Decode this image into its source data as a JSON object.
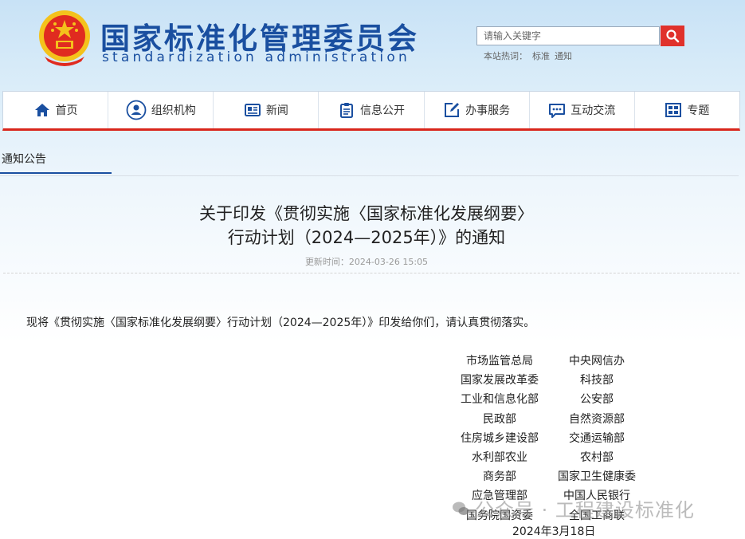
{
  "header": {
    "title": "国家标准化管理委员会",
    "subtitle": "standardization administration",
    "search_placeholder": "请输入关键字",
    "hot_label": "本站热词：",
    "hot_words": [
      "标准",
      "通知"
    ]
  },
  "nav": {
    "items": [
      {
        "label": "首页",
        "icon": "home-icon"
      },
      {
        "label": "组织机构",
        "icon": "person-icon"
      },
      {
        "label": "新闻",
        "icon": "newspaper-icon"
      },
      {
        "label": "信息公开",
        "icon": "clipboard-icon"
      },
      {
        "label": "办事服务",
        "icon": "edit-icon"
      },
      {
        "label": "互动交流",
        "icon": "chat-icon"
      },
      {
        "label": "专题",
        "icon": "grid-icon"
      }
    ]
  },
  "breadcrumb": "通知公告",
  "article": {
    "title_line1": "关于印发《贯彻实施〈国家标准化发展纲要〉",
    "title_line2": "行动计划（2024—2025年）》的通知",
    "update_time": "更新时间：2024-03-26 15:05",
    "body": "现将《贯彻实施〈国家标准化发展纲要〉行动计划（2024—2025年）》印发给你们，请认真贯彻落实。",
    "signers": [
      [
        "市场监管总局",
        "中央网信办"
      ],
      [
        "国家发展改革委",
        "科技部"
      ],
      [
        "工业和信息化部",
        "公安部"
      ],
      [
        "民政部",
        "自然资源部"
      ],
      [
        "住房城乡建设部",
        "交通运输部"
      ],
      [
        "水利部农业",
        "农村部"
      ],
      [
        "商务部",
        "国家卫生健康委"
      ],
      [
        "应急管理部",
        "中国人民银行"
      ],
      [
        "国务院国资委",
        "全国工商联"
      ]
    ],
    "date": "2024年3月18日"
  },
  "watermark": "公众号 · 工程建设标准化",
  "colors": {
    "brand_blue": "#1a4fa0",
    "accent_red": "#d9261c"
  }
}
